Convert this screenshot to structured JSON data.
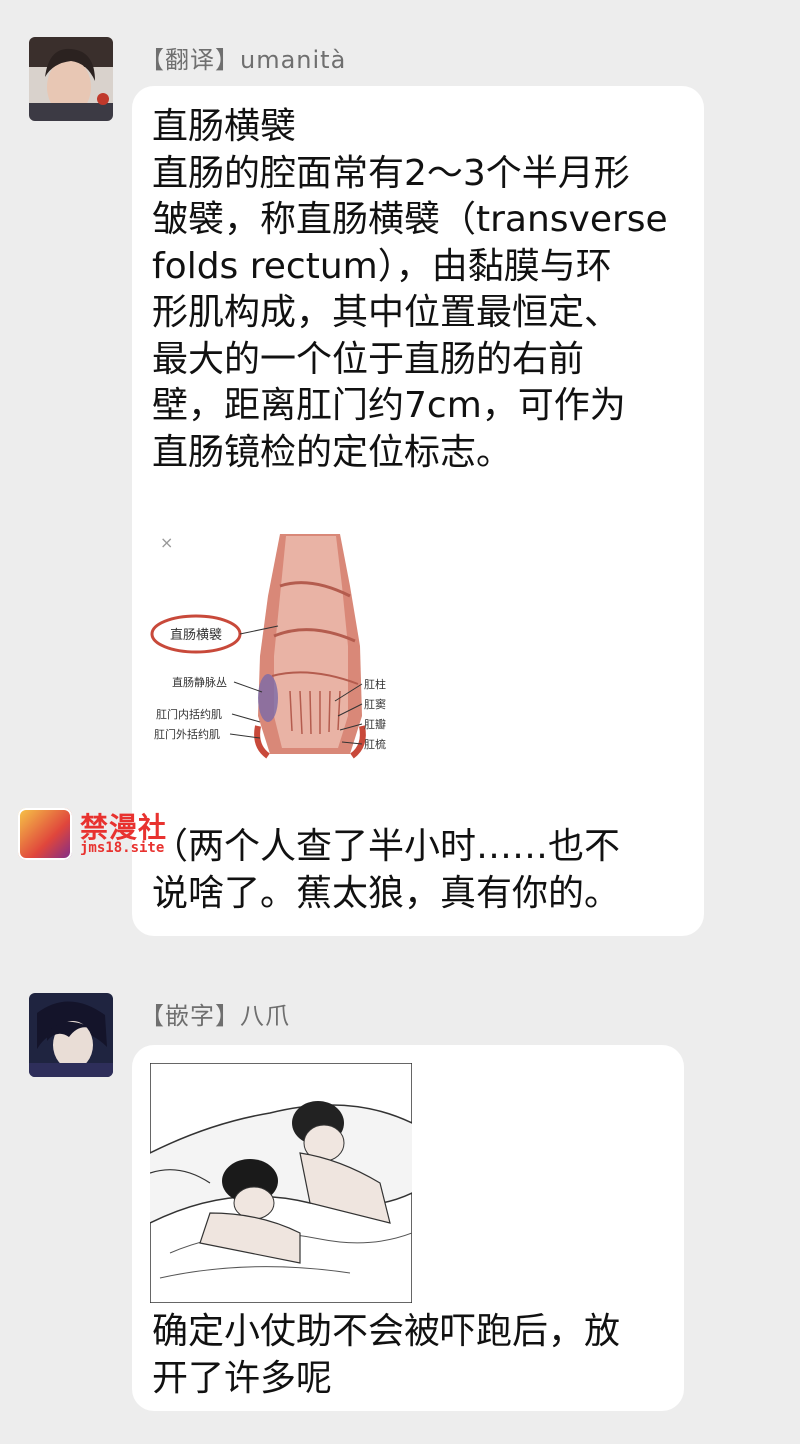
{
  "messages": [
    {
      "sender": "【翻译】umanità",
      "text": "直肠横襞\n直肠的腔面常有2～3个半月形\n皱襞，称直肠横襞（transverse\n folds rectum），由黏膜与环\n形肌构成，其中位置最恒定、\n最大的一个位于直肠的右前\n壁，距离肛门约7cm，可作为\n直肠镜检的定位标志。",
      "figure_labels": {
        "circled": "直肠横襞",
        "left": [
          "直肠静脉丛",
          "肛门内括约肌",
          "肛门外括约肌"
        ],
        "right": [
          "肛柱",
          "肛窦",
          "肛瓣",
          "肛梳"
        ]
      },
      "caption": "（两个人查了半小时……也不\n说啥了。蕉太狼，真有你的。"
    },
    {
      "sender": "【嵌字】八爪",
      "caption": "确定小仗助不会被吓跑后，放\n开了许多呢"
    }
  ],
  "watermark": {
    "title": "禁漫社",
    "url": "jms18.site"
  },
  "colors": {
    "background": "#ededed",
    "bubble": "#ffffff",
    "sender_text": "#6f6f6f",
    "watermark": "#e8322f",
    "anatomy_red": "#c8493a"
  }
}
